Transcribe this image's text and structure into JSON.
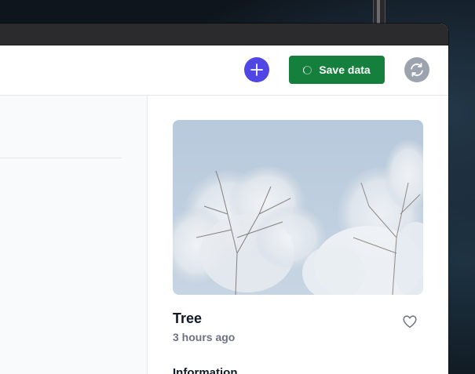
{
  "toolbar": {
    "add_icon": "plus-icon",
    "save_label": "Save data",
    "save_icon": "spinner-icon",
    "refresh_icon": "refresh-icon",
    "colors": {
      "add": "#4f46e5",
      "save": "#15803d",
      "refresh": "#9ca3af"
    }
  },
  "detail": {
    "image_alt": "Snow-covered trees against a pale blue sky",
    "title": "Tree",
    "subtitle": "3 hours ago",
    "favorite_icon": "heart-icon",
    "section_heading": "Information"
  }
}
